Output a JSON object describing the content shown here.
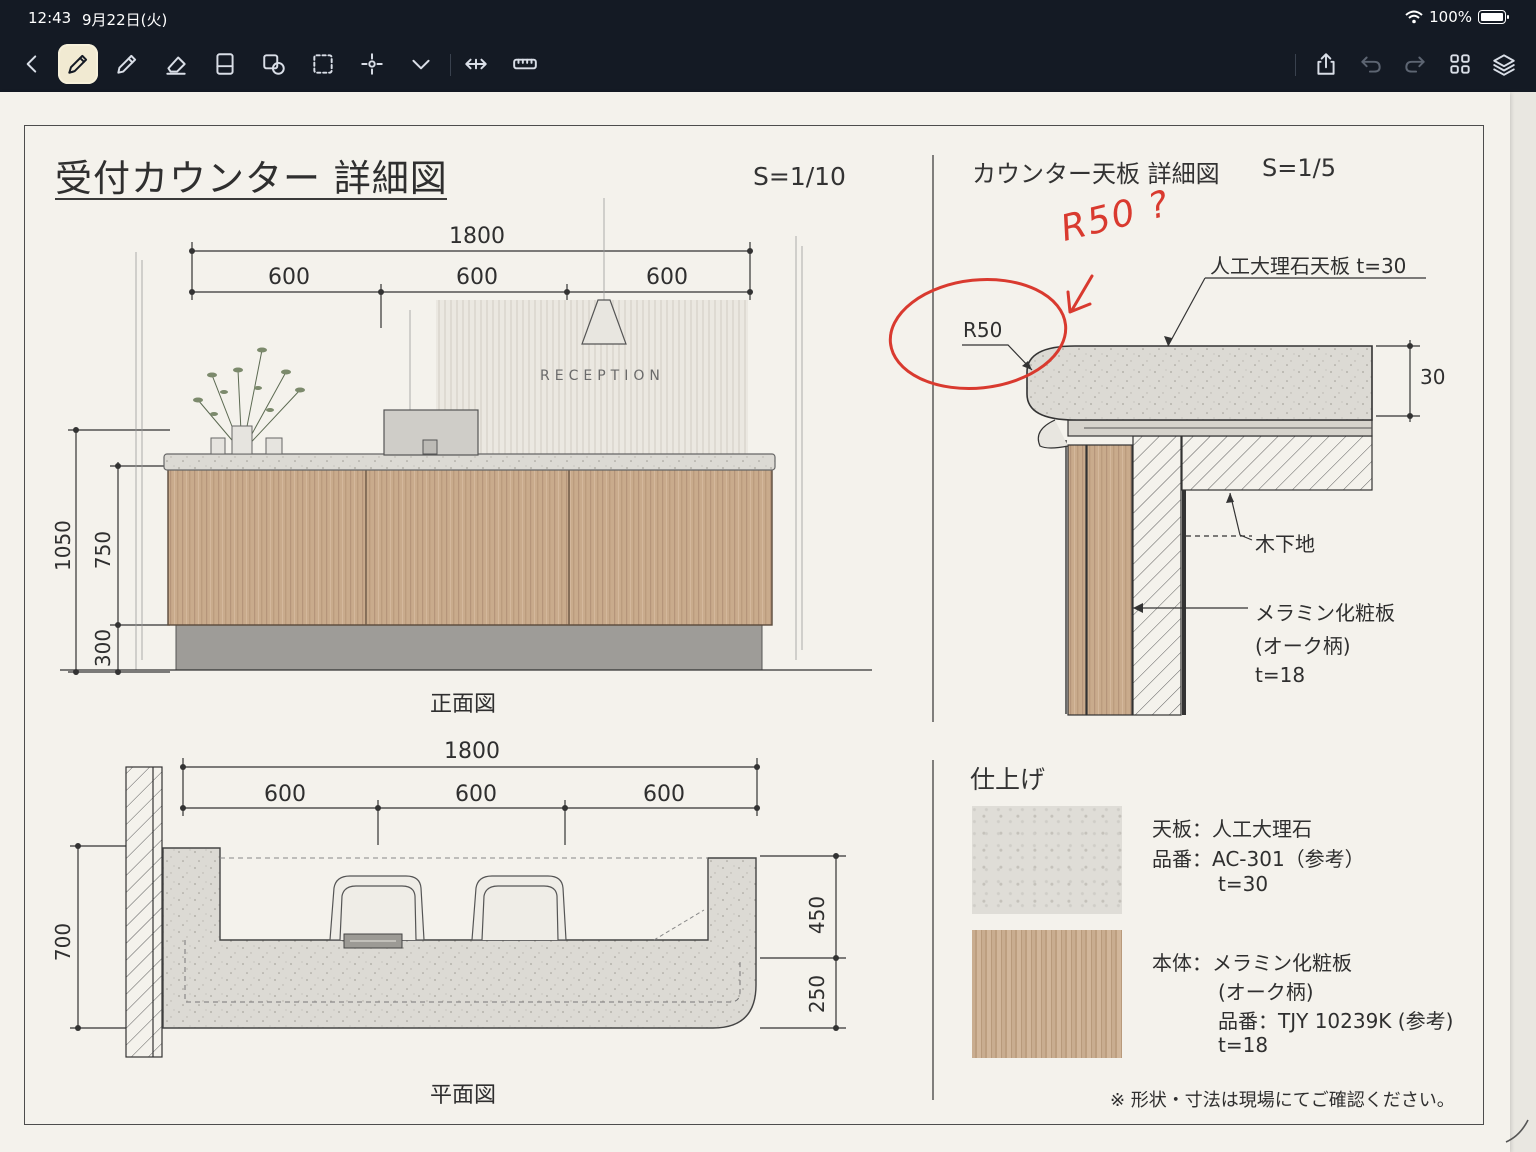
{
  "status": {
    "time": "12:43",
    "date": "9月22日(火)",
    "battery": "100%"
  },
  "toolbar": {
    "tools": [
      "back",
      "pen",
      "pencil",
      "eraser",
      "page",
      "shapes",
      "lasso",
      "laser",
      "more",
      "fit-width",
      "ruler"
    ],
    "right_tools": [
      "share",
      "undo",
      "redo",
      "grid",
      "layers"
    ]
  },
  "drawing": {
    "title": "受付カウンター 詳細図",
    "scale_main": "S=1/10",
    "front_view_label": "正面図",
    "plan_view_label": "平面図",
    "reception_sign": "RECEPTION",
    "front_dims": {
      "total": "1800",
      "seg1": "600",
      "seg2": "600",
      "seg3": "600",
      "h_total": "1050",
      "h_top": "750",
      "h_base": "300"
    },
    "plan_dims": {
      "total": "1800",
      "seg1": "600",
      "seg2": "600",
      "seg3": "600",
      "depth": "700",
      "d1": "450",
      "d2": "250"
    },
    "detail": {
      "title": "カウンター天板 詳細図",
      "scale": "S=1/5",
      "radius": "R50",
      "top_label": "人工大理石天板 t=30",
      "thickness": "30",
      "wood_base": "木下地",
      "melamine_1": "メラミン化粧板",
      "melamine_2": "(オーク柄)",
      "melamine_3": "t=18"
    },
    "annotation": "R50 ?",
    "finish": {
      "heading": "仕上げ",
      "top_line1": "天板：人工大理石",
      "top_line2": "品番：AC-301（参考）",
      "top_line3": "t=30",
      "body_line1": "本体：メラミン化粧板",
      "body_line2": "(オーク柄)",
      "body_line3": "品番：TJY 10239K (参考)",
      "body_line4": "t=18"
    },
    "note": "※ 形状・寸法は現場にてご確認ください。"
  }
}
